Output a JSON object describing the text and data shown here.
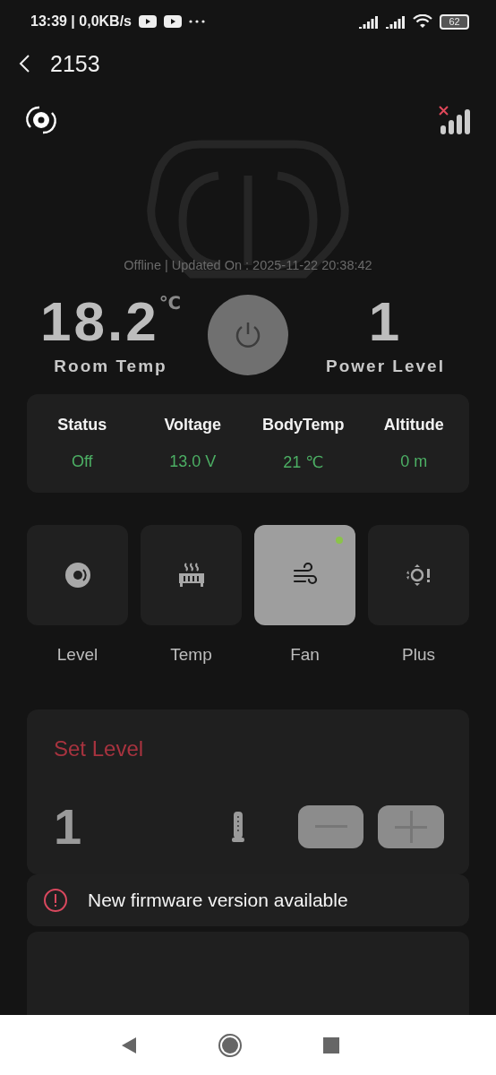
{
  "status_bar": {
    "time": "13:39 | 0,0KB/s",
    "battery": "62"
  },
  "header": {
    "title": "2153"
  },
  "device": {
    "connected": false,
    "status_line": "Offline | Updated On : 2025-11-22 20:38:42"
  },
  "room_temp": {
    "value": "18.2",
    "unit": "℃",
    "label": "Room Temp"
  },
  "power": {
    "on": false
  },
  "power_level": {
    "value": "1",
    "label": "Power Level"
  },
  "stats": [
    {
      "label": "Status",
      "value": "Off"
    },
    {
      "label": "Voltage",
      "value": "13.0 V"
    },
    {
      "label": "BodyTemp",
      "value": "21 ℃"
    },
    {
      "label": "Altitude",
      "value": "0 m"
    }
  ],
  "modes": [
    {
      "kind": "level",
      "label": "Level",
      "selected": false
    },
    {
      "kind": "temp",
      "label": "Temp",
      "selected": false
    },
    {
      "kind": "fan",
      "label": "Fan",
      "selected": true
    },
    {
      "kind": "plus",
      "label": "Plus",
      "selected": false
    }
  ],
  "set_level": {
    "title": "Set Level",
    "value": "1"
  },
  "alert": {
    "text": "New firmware version available"
  }
}
